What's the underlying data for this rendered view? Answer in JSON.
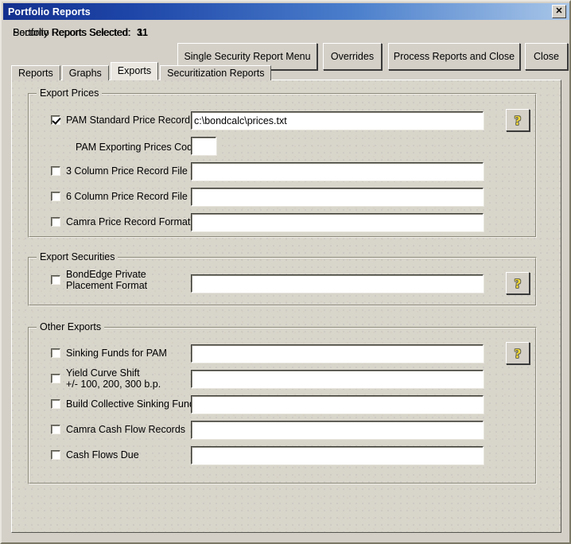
{
  "window": {
    "title": "Portfolio Reports",
    "close_icon": "close-icon",
    "close_glyph": "✕"
  },
  "header": {
    "portfolio_reports_label": "Portfolio Reports Selected:",
    "portfolio_reports_count": "11",
    "security_reports_label": "Security Reports Selected:",
    "security_reports_count": "3",
    "buttons": [
      {
        "label": "Single Security Report Menu"
      },
      {
        "label": "Overrides"
      },
      {
        "label": "Process Reports and Close"
      },
      {
        "label": "Close"
      }
    ]
  },
  "tabs": [
    {
      "label": "Reports",
      "active": false
    },
    {
      "label": "Graphs",
      "active": false
    },
    {
      "label": "Exports",
      "active": true
    },
    {
      "label": "Securitization Reports",
      "active": false
    }
  ],
  "groups": {
    "export_prices": {
      "title": "Export Prices",
      "rows": [
        {
          "label": "PAM Standard Price Record File",
          "checked": true,
          "value": "c:\\bondcalc\\prices.txt",
          "placeholder": ""
        },
        {
          "label": "3 Column Price Record File",
          "checked": false,
          "value": "",
          "placeholder": ""
        },
        {
          "label": "6 Column Price Record File",
          "checked": false,
          "value": "",
          "placeholder": ""
        },
        {
          "label": "Camra Price Record Format",
          "checked": false,
          "value": "",
          "placeholder": ""
        }
      ],
      "code_label": "PAM Exporting Prices Code:",
      "code_value": "",
      "code_placeholder": "",
      "help_icon": "help-question-icon"
    },
    "export_securities": {
      "title": "Export Securities",
      "rows": [
        {
          "label": "BondEdge Private\nPlacement Format",
          "checked": false,
          "value": "",
          "placeholder": ""
        }
      ],
      "help_icon": "help-question-icon"
    },
    "other_exports": {
      "title": "Other Exports",
      "rows": [
        {
          "label": "Sinking Funds for PAM",
          "checked": false,
          "value": "",
          "placeholder": ""
        },
        {
          "label": "Yield Curve Shift\n+/- 100, 200, 300 b.p.",
          "checked": false,
          "value": "",
          "placeholder": ""
        },
        {
          "label": "Build Collective Sinking Funds",
          "checked": false,
          "value": "",
          "placeholder": ""
        },
        {
          "label": "Camra Cash Flow Records",
          "checked": false,
          "value": "",
          "placeholder": ""
        },
        {
          "label": "Cash Flows Due",
          "checked": false,
          "value": "",
          "placeholder": ""
        }
      ],
      "help_icon": "help-question-icon"
    }
  },
  "help_glyph": "?",
  "colors": {
    "window_face": "#d4d0c8",
    "panel_face": "#d8d5cb",
    "title_start": "#14308e",
    "title_end": "#a8c6e8",
    "help_yellow": "#ffe033",
    "field_bg": "#ffffff"
  }
}
